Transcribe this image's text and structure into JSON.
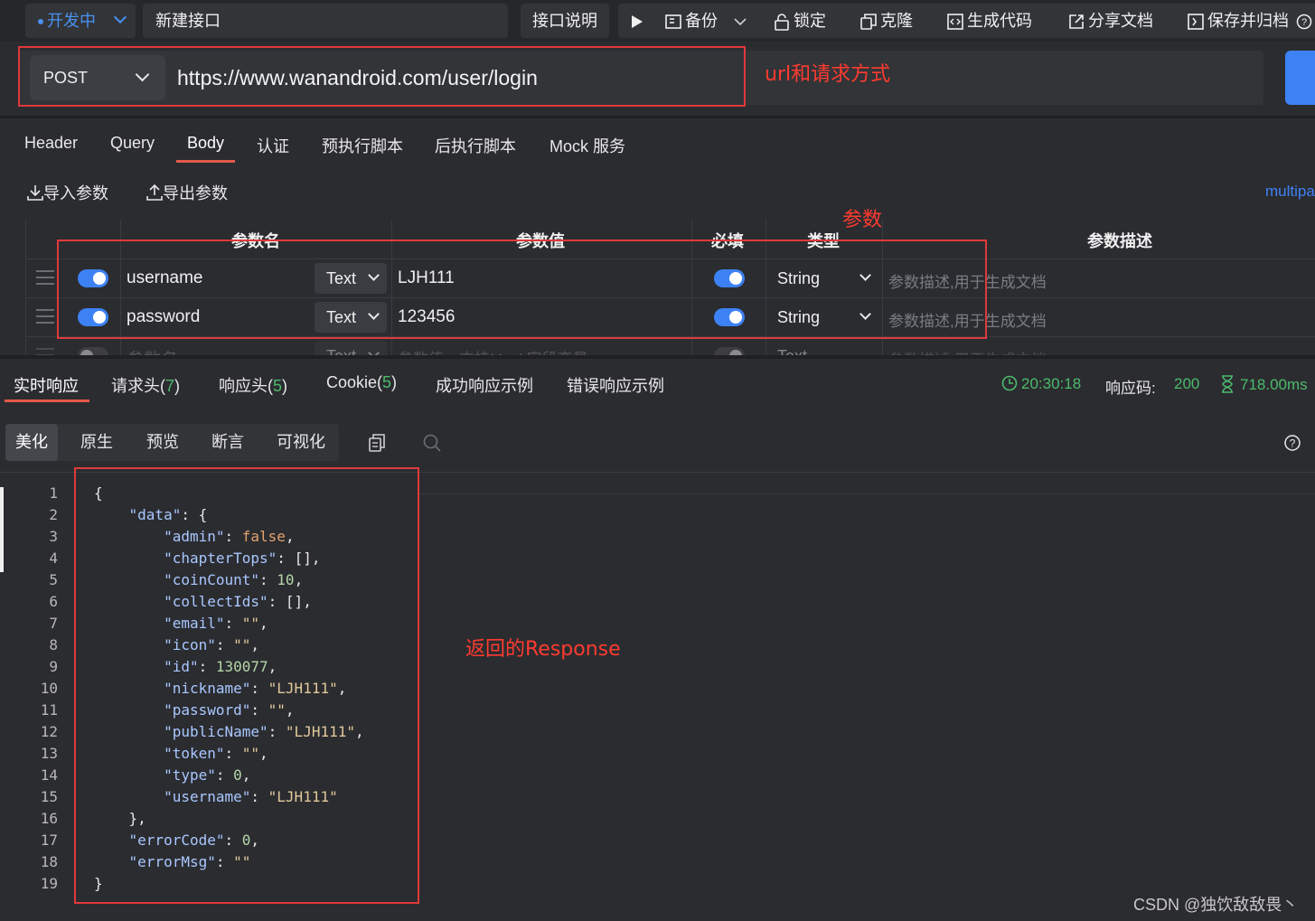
{
  "toolbar": {
    "status": "开发中",
    "api_name": "新建接口",
    "description_button": "接口说明",
    "backup": "备份",
    "lock": "锁定",
    "clone": "克隆",
    "gen_code": "生成代码",
    "share_doc": "分享文档",
    "save_archive": "保存并归档"
  },
  "request": {
    "method": "POST",
    "url": "https://www.wanandroid.com/user/login"
  },
  "annotations": {
    "url_method": "url和请求方式",
    "params": "参数",
    "response": "返回的Response"
  },
  "request_tabs": [
    "Header",
    "Query",
    "Body",
    "认证",
    "预执行脚本",
    "后执行脚本",
    "Mock 服务"
  ],
  "body": {
    "import_params": "导入参数",
    "export_params": "导出参数",
    "content_type": "multipa"
  },
  "param_table": {
    "headers": [
      "参数名",
      "参数值",
      "必填",
      "类型",
      "参数描述"
    ],
    "rows": [
      {
        "name": "username",
        "field_type": "Text",
        "value": "LJH111",
        "data_type": "String",
        "desc_placeholder": "参数描述,用于生成文档"
      },
      {
        "name": "password",
        "field_type": "Text",
        "value": "123456",
        "data_type": "String",
        "desc_placeholder": "参数描述,用于生成文档"
      },
      {
        "name": "参数名",
        "field_type": "Text",
        "value": "参数值，支持Mock字段变量",
        "data_type": "Text",
        "desc_placeholder": "参数描述,用于生成文档"
      }
    ]
  },
  "response_tabs": {
    "realtime": "实时响应",
    "req_headers": "请求头(",
    "req_headers_count": "7",
    "resp_headers": "响应头(",
    "resp_headers_count": "5",
    "cookie": "Cookie(",
    "cookie_count": "5",
    "close": ")",
    "success_example": "成功响应示例",
    "error_example": "错误响应示例"
  },
  "response_meta": {
    "time": "20:30:18",
    "code_label": "响应码:",
    "code": "200",
    "duration": "718.00ms"
  },
  "view_tabs": [
    "美化",
    "原生",
    "预览",
    "断言",
    "可视化"
  ],
  "response_json_lines": [
    "{",
    "    \"data\": {",
    "        \"admin\": false,",
    "        \"chapterTops\": [],",
    "        \"coinCount\": 10,",
    "        \"collectIds\": [],",
    "        \"email\": \"\",",
    "        \"icon\": \"\",",
    "        \"id\": 130077,",
    "        \"nickname\": \"LJH111\",",
    "        \"password\": \"\",",
    "        \"publicName\": \"LJH111\",",
    "        \"token\": \"\",",
    "        \"type\": 0,",
    "        \"username\": \"LJH111\"",
    "    },",
    "    \"errorCode\": 0,",
    "    \"errorMsg\": \"\"",
    "}"
  ],
  "watermark": "CSDN @独饮敌敌畏丶",
  "colors": {
    "accent_blue": "#3d82f5",
    "success_green": "#4cbb6c",
    "annotation_red": "#ff3b30",
    "tab_underline": "#e25a4a"
  }
}
